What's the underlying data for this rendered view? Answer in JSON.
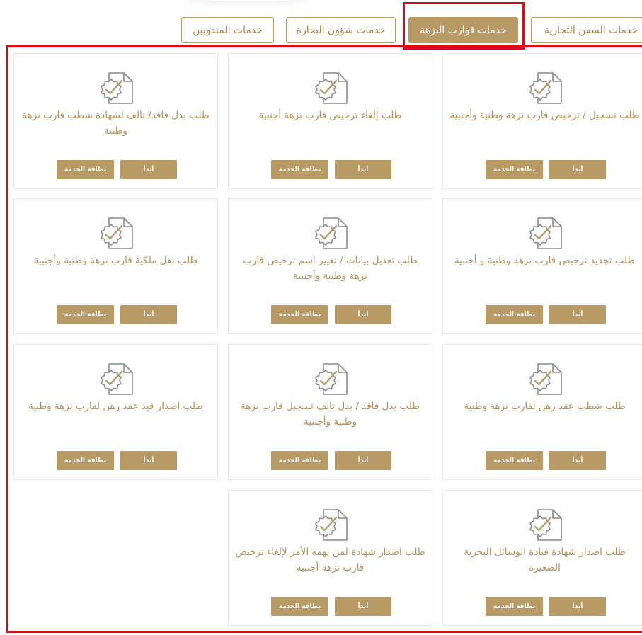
{
  "tabs": [
    {
      "label": "خدمات السفن التجارية",
      "active": false
    },
    {
      "label": "خدمات قوارب النزهة",
      "active": true
    },
    {
      "label": "خدمات شؤون البحارة",
      "active": false
    },
    {
      "label": "خدمات المندوبين",
      "active": false
    }
  ],
  "buttons": {
    "start": "أبدأ",
    "card": "بطاقة الخدمة"
  },
  "services": [
    {
      "title": "طلب تسجيل / ترخيص قارب نزهة وطنية وأجنبية"
    },
    {
      "title": "طلب إلغاء ترخيص قارب نزهة أجنبية"
    },
    {
      "title": "طلب بدل فاقد/ تالف لشهادة شطب قارب نزهة وطنية"
    },
    {
      "title": "طلب تجديد ترخيص قارب نزهه وطنية و أجنبية"
    },
    {
      "title": "طلب تعديل بيانات / تغيير اسم ترخيص قارب نزهة وطنية وأجنبية"
    },
    {
      "title": "طلب نقل ملكية قارب نزهة وطنية وأجنبية"
    },
    {
      "title": "طلب شطب عقد رهن لقارب نزهة وطنية"
    },
    {
      "title": "طلب بدل فاقد / بدل تالف تسجيل قارب نزهة وطنية وأجنبية"
    },
    {
      "title": "طلب اصدار قيد عقد رهن لقارب نزهة وطنية"
    },
    {
      "title": "طلب اصدار شهادة قيادة الوسائل البحرية الصغيرة"
    },
    {
      "title": "طلب اصدار شهادة لمن يهمه الأمر لإلغاء ترخيص قارب نزهة أجنبية"
    }
  ]
}
